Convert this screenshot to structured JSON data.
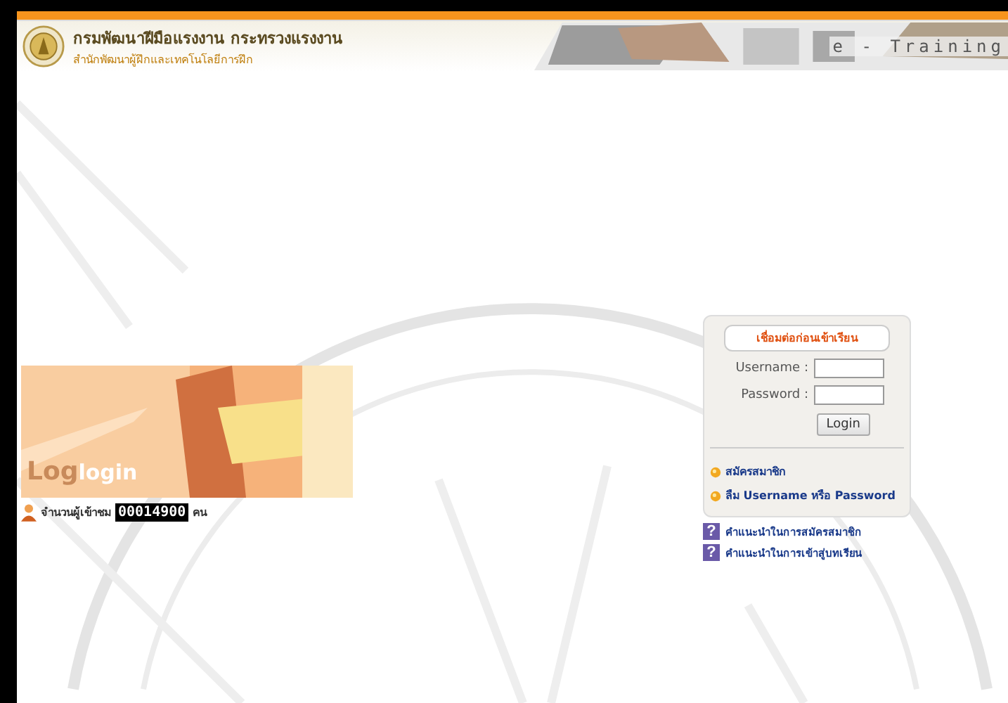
{
  "header": {
    "title": "กรมพัฒนาฝีมือแรงงาน กระทรวงแรงงาน",
    "subtitle": "สำนักพัฒนาผู้ฝึกและเทคโนโลยีการฝึก",
    "banner_text": "e - Training"
  },
  "login_banner": {
    "faded_text": "Log",
    "text": "login"
  },
  "visitors": {
    "label": "จำนวนผู้เข้าชม",
    "count": "00014900",
    "unit": "คน"
  },
  "login_panel": {
    "heading": "เชื่อมต่อก่อนเข้าเรียน",
    "fields": [
      {
        "label": "Username :"
      },
      {
        "label": "Password :"
      }
    ],
    "button": "Login",
    "links": [
      {
        "text": "สมัครสมาชิก"
      },
      {
        "text": "ลืม Username หรือ Password"
      }
    ]
  },
  "help_links": [
    {
      "icon": "?",
      "text": "คำแนะนำในการสมัครสมาชิก"
    },
    {
      "icon": "?",
      "text": "คำแนะนำในการเข้าสู่บทเรียน"
    }
  ]
}
